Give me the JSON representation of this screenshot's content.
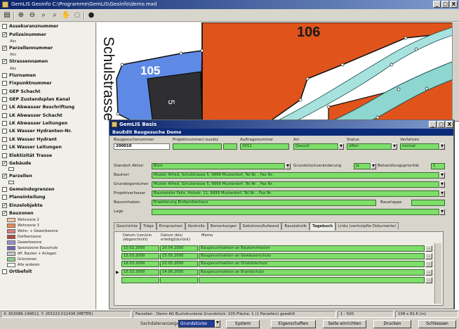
{
  "window": {
    "title": "GemLIS Geoinfo C:\\Programme\\GemLIS\\Geoinfo\\demo.mxd",
    "minimize": "_",
    "maximize": "□",
    "close": "X"
  },
  "toolbar": {
    "icons": [
      "layer-icon",
      "zoom-in-icon",
      "zoom-out-icon",
      "zoom-extent-icon",
      "pan-hand-icon",
      "identify-icon"
    ]
  },
  "layers": {
    "items": [
      {
        "label": "Assekuranznummer",
        "checked": false
      },
      {
        "label": "Polizeinummer",
        "checked": true,
        "sub": "Abc"
      },
      {
        "label": "Parzellennummer",
        "checked": true,
        "sub": "Abc"
      },
      {
        "label": "Strassennamen",
        "checked": true,
        "sub": "Abc"
      },
      {
        "label": "Flurnamen",
        "checked": false
      },
      {
        "label": "Fixpunktnummer",
        "checked": false
      },
      {
        "label": "GEP Schacht",
        "checked": false
      },
      {
        "label": "GEP Zustandsplan Kanal",
        "checked": false
      },
      {
        "label": "LK Abwasser Beschriftung",
        "checked": false
      },
      {
        "label": "LK Abwasser Schacht",
        "checked": false
      },
      {
        "label": "LK Abwasser Leitungen",
        "checked": false
      },
      {
        "label": "LK Wasser Hydranten-Nr.",
        "checked": false
      },
      {
        "label": "LK Wasser Hydrant",
        "checked": false
      },
      {
        "label": "LK Wasser Leitungen",
        "checked": false
      },
      {
        "label": "Elektizität Trasse",
        "checked": false
      },
      {
        "label": "Gebäude",
        "checked": true,
        "swatch": true
      },
      {
        "label": "Parzellen",
        "checked": true,
        "swatch": true
      },
      {
        "label": "Gemeindegrenzen",
        "checked": false
      },
      {
        "label": "Planeinteilung",
        "checked": false
      },
      {
        "label": "Einzelobjekte",
        "checked": true
      }
    ],
    "bauzonen": {
      "label": "Bauzonen",
      "checked": true,
      "legend": [
        {
          "label": "Wohnzone 2",
          "color": "#f6c9a4"
        },
        {
          "label": "Wohnzone 3",
          "color": "#f08b55"
        },
        {
          "label": "Wohn- + Gewerbezone",
          "color": "#e07a7a"
        },
        {
          "label": "Dorfkernzone",
          "color": "#b44a3a"
        },
        {
          "label": "Gewerbezone",
          "color": "#9b8fd1"
        },
        {
          "label": "Spezialzone Bauschule",
          "color": "#7066b8"
        },
        {
          "label": "öff. Bauten + Anlagen",
          "color": "#c8c8c8"
        },
        {
          "label": "Grünzonen",
          "color": "#8fd08a"
        },
        {
          "label": "Alle anderen",
          "color": "#ffffff"
        }
      ]
    },
    "last": "Ortbefolt"
  },
  "map": {
    "parcel_106": "106",
    "parcel_105": "105",
    "parcel_5": "5",
    "street": "Schulstrasse",
    "colors": {
      "building_orange": "#e0541c",
      "parcel_blue": "#5e8ae6",
      "building_dark": "#2e2e33",
      "street_teal": "#8ed6d0"
    }
  },
  "dialog": {
    "title": "GemLIS Basis",
    "subtitle": "BauEdit Baugesuche Demo",
    "headers": {
      "baugesuchsnummer": "Baugesuchsnummer",
      "projektnummer": "Projektnummer/-zusatz",
      "auftragsnummer": "Auftragsnummer",
      "art": "Art",
      "status": "Status",
      "verfahren": "Verfahren"
    },
    "values": {
      "baugesuchsnummer": "200010",
      "auftragsnummer": "2012",
      "art": "Gesuch",
      "status": "offen",
      "verfahren": "normal"
    },
    "labels": {
      "standort": "Standort Akten",
      "grundstueck": "Grundstückveränderung",
      "behandlung": "Behandlungspriorität",
      "bauherr": "Bauherr",
      "eigentuemer": "Grundeigentümer",
      "verfasser": "Projektverfasser",
      "vorhaben": "Bauvorhaben",
      "lage": "Lage",
      "bauetappe": "Bauetappe"
    },
    "fields": {
      "standort": "Büro",
      "grundstueck": "ja",
      "behandlung": "1",
      "bauherr": "Muster Alfred, Schulstrasse 5, 9999 Musterdorf, Tel.Nr. , Fax Nr.",
      "eigentuemer": "Muster Alfred, Schulstrasse 5, 9999 Musterdorf, Tel.Nr. , Fax Nr.",
      "verfasser": "Baumeister Felix, Holzstr. 11, 9999 Musterdorf, Tel.Nr. , Fax Nr.",
      "vorhaben": "Erweiterung Einfamilienhaus"
    },
    "tabs": [
      "Geschichte",
      "Träge",
      "Einsprachen",
      "Kontrolle",
      "Bemerkungen",
      "Gebühren/Aufwand",
      "Baustatistik",
      "Tagebuch",
      "Links (verknüpfte Dokumente)"
    ],
    "active_tab": 7,
    "table": {
      "col_von": "Datum (von/ein\n/abgeschickt)",
      "col_bis": "Datum (bis/\nerledigt/zurück)",
      "col_memo": "Memo",
      "rows": [
        {
          "von": "10.02.2000",
          "bis": "20.04.2000",
          "memo": "Baugesuchsakten an Baukommission"
        },
        {
          "von": "15.03.2000",
          "bis": "15.05.2000",
          "memo": "Baugesuchsakten an Gewässerschutz"
        },
        {
          "von": "16.03.2000",
          "bis": "22.05.2000",
          "memo": "Baugesuchsakten an Ortsbildschutz"
        },
        {
          "von": "15.03.2000",
          "bis": "14.06.2000",
          "memo": "Baugesuchsakten an Brandschutz"
        },
        {
          "von": "",
          "bis": "",
          "memo": ""
        }
      ]
    }
  },
  "statusbar": {
    "coords": "X: 653086.149812, Y: 255223.012436 [METER]",
    "info": "Parzellen : Demo AG Buchdruckerei Grundstück: 105-Fläche: 1 (1 Parzellen) gewählt",
    "scale": "1 : 500",
    "size": "108 x 82.6 (m)"
  },
  "bottombar": {
    "sachdaten_label": "Sachdatenanzeige",
    "sachdaten_value": "Grundstücke",
    "system": "System",
    "eigenschaften": "Eigenschaften",
    "seite": "Seite einrichten",
    "drucken": "Drucken",
    "schliessen": "Schliessen"
  }
}
